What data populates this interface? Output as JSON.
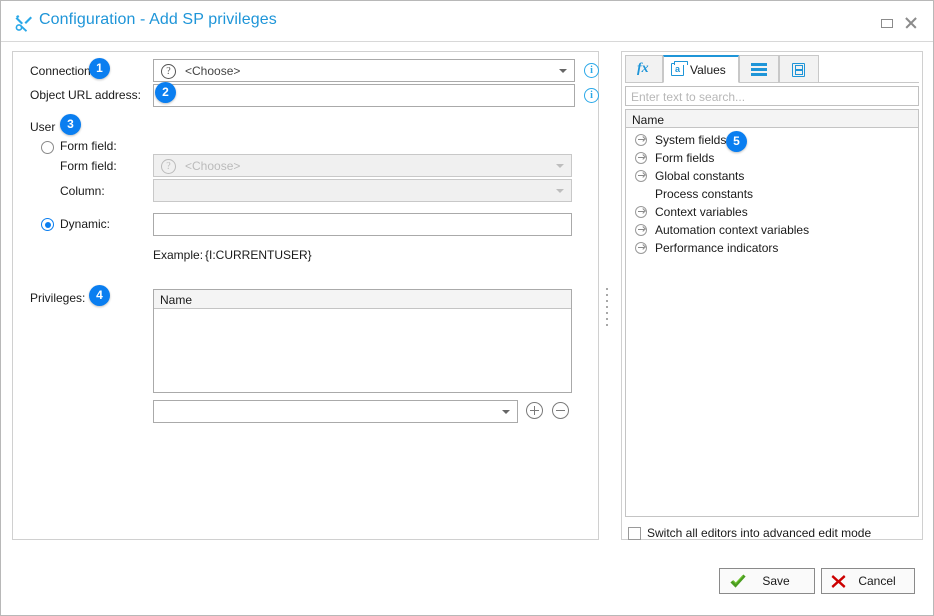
{
  "window": {
    "title": "Configuration - Add SP privileges",
    "icon": "tools-icon",
    "maximize_label": "Maximize",
    "close_label": "Close"
  },
  "form": {
    "connection": {
      "label": "Connection:",
      "badge": "1",
      "value": "<Choose>",
      "icon": "question-mark-icon",
      "info": "i"
    },
    "object_url": {
      "label": "Object URL address:",
      "badge": "2",
      "value": "",
      "info": "i"
    },
    "user": {
      "label": "User",
      "badge": "3",
      "form_field_radio_label": "Form field:",
      "form_field_label": "Form field:",
      "form_field_value": "<Choose>",
      "column_label": "Column:",
      "column_value": "",
      "dynamic_radio_label": "Dynamic:",
      "dynamic_value": "",
      "example_label": "Example:",
      "example_value": "{I:CURRENTUSER}",
      "selected": "dynamic"
    },
    "privileges": {
      "label": "Privileges:",
      "badge": "4",
      "column_header": "Name",
      "rows": [],
      "combo_value": "",
      "add_label": "Add",
      "remove_label": "Remove"
    }
  },
  "side": {
    "tabs": [
      {
        "label": "",
        "icon": "function-fx-icon",
        "active": false
      },
      {
        "label": "Values",
        "icon": "values-document-icon",
        "active": true
      },
      {
        "label": "",
        "icon": "list-icon",
        "active": false
      },
      {
        "label": "",
        "icon": "boxed-list-icon",
        "active": false
      }
    ],
    "search_placeholder": "Enter text to search...",
    "search_value": "",
    "column_header": "Name",
    "badge": "5",
    "tree_items": [
      {
        "label": "System fields",
        "has_arrow": true
      },
      {
        "label": "Form fields",
        "has_arrow": true
      },
      {
        "label": "Global constants",
        "has_arrow": true
      },
      {
        "label": "Process constants",
        "has_arrow": false
      },
      {
        "label": "Context variables",
        "has_arrow": true
      },
      {
        "label": "Automation context variables",
        "has_arrow": true
      },
      {
        "label": "Performance indicators",
        "has_arrow": true
      }
    ],
    "advanced_mode": {
      "label": "Switch all editors into advanced edit mode",
      "checked": false
    }
  },
  "footer": {
    "save_label": "Save",
    "cancel_label": "Cancel"
  },
  "colors": {
    "accent": "#1e95d8",
    "badge": "#0a7ef0",
    "save_green": "#4a9c20",
    "cancel_red": "#cc0000"
  }
}
